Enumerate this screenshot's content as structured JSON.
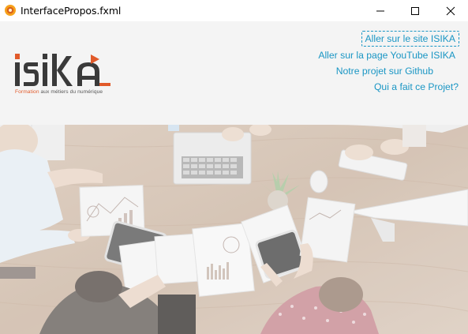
{
  "window": {
    "title": "InterfacePropos.fxml",
    "app_icon": "javafx-app-icon"
  },
  "header": {
    "logo": {
      "text": "ISIKA",
      "tagline_accent": "Formation",
      "tagline_rest": " aux métiers du numérique",
      "colors": {
        "dark": "#3a3a3a",
        "accent": "#e15a2a"
      }
    },
    "links": [
      {
        "label": "Aller sur le site ISIKA"
      },
      {
        "label": "Aller sur la page YouTube ISIKA"
      },
      {
        "label": "Notre projet sur Github"
      },
      {
        "label": "Qui a fait ce Projet?"
      }
    ],
    "link_color": "#1a96c4",
    "background": "#f4f4f4"
  },
  "banner": {
    "description_icon": "team-desk-photo"
  }
}
